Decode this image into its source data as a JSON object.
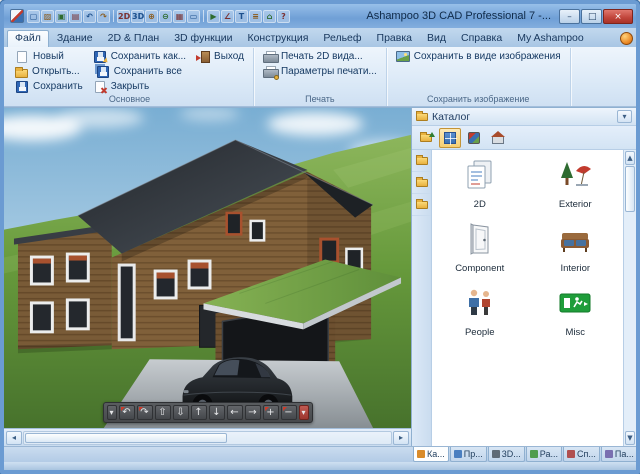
{
  "window": {
    "title": "Ashampoo 3D CAD Professional 7 -...",
    "controls": {
      "minimize": "–",
      "maximize": "□",
      "close": "×"
    }
  },
  "qat": {
    "icons": [
      {
        "name": "new-document-icon",
        "glyph": "▢"
      },
      {
        "name": "open-project-icon",
        "glyph": "▨"
      },
      {
        "name": "save-icon",
        "glyph": "▣"
      },
      {
        "name": "print-icon",
        "glyph": "▤"
      },
      {
        "name": "undo-icon",
        "glyph": "↶"
      },
      {
        "name": "redo-icon",
        "glyph": "↷"
      },
      {
        "name": "view-2d-icon",
        "glyph": "2D"
      },
      {
        "name": "view-3d-icon",
        "glyph": "3D"
      },
      {
        "name": "zoom-in-icon",
        "glyph": "⊕"
      },
      {
        "name": "zoom-out-icon",
        "glyph": "⊖"
      },
      {
        "name": "grid-icon",
        "glyph": "▦"
      },
      {
        "name": "ruler-icon",
        "glyph": "▭"
      },
      {
        "name": "selection-arrow-icon",
        "glyph": "▶"
      },
      {
        "name": "measure-icon",
        "glyph": "∠"
      },
      {
        "name": "text-icon",
        "glyph": "T"
      },
      {
        "name": "layers-icon",
        "glyph": "≡"
      },
      {
        "name": "home-view-icon",
        "glyph": "⌂"
      },
      {
        "name": "help-icon",
        "glyph": "?"
      }
    ]
  },
  "ribbon": {
    "tabs": [
      "Файл",
      "Здание",
      "2D & План",
      "3D функции",
      "Конструкция",
      "Рельеф",
      "Правка",
      "Вид",
      "Справка",
      "My Ashampoo"
    ],
    "active_tab": "Файл",
    "groups": {
      "main": {
        "label": "Основное",
        "buttons": [
          "Новый",
          "Открыть...",
          "Сохранить",
          "Сохранить как...",
          "Сохранить все",
          "Закрыть",
          "Выход"
        ]
      },
      "print": {
        "label": "Печать",
        "buttons": [
          "Печать 2D вида...",
          "Параметры печати..."
        ]
      },
      "save_image": {
        "label": "Сохранить изображение",
        "buttons": [
          "Сохранить в виде изображения"
        ]
      }
    }
  },
  "viewport": {
    "nav": [
      {
        "name": "nav-menu-left-icon",
        "glyph": "▾"
      },
      {
        "name": "rotate-left-icon",
        "glyph": "↶"
      },
      {
        "name": "rotate-right-icon",
        "glyph": "↷"
      },
      {
        "name": "tilt-up-icon",
        "glyph": "⇧"
      },
      {
        "name": "tilt-down-icon",
        "glyph": "⇩"
      },
      {
        "name": "move-up-icon",
        "glyph": "↑"
      },
      {
        "name": "move-down-icon",
        "glyph": "↓"
      },
      {
        "name": "move-left-icon",
        "glyph": "←"
      },
      {
        "name": "move-right-icon",
        "glyph": "→"
      },
      {
        "name": "zoom-in-nav-icon",
        "glyph": "+"
      },
      {
        "name": "zoom-out-nav-icon",
        "glyph": "−"
      },
      {
        "name": "nav-menu-right-icon",
        "glyph": "▾"
      }
    ],
    "hscroll": {
      "left": "◂",
      "right": "▸"
    }
  },
  "catalog": {
    "title": "Каталог",
    "options_glyph": "▾",
    "toolbar": [
      {
        "name": "folder-up-icon"
      },
      {
        "name": "grid-view-icon"
      },
      {
        "name": "materials-icon"
      },
      {
        "name": "home-icon"
      }
    ],
    "scrollbar": {
      "up": "▲",
      "down": "▼"
    },
    "items": [
      {
        "label": "2D"
      },
      {
        "label": "Exterior"
      },
      {
        "label": "Component"
      },
      {
        "label": "Interior"
      },
      {
        "label": "People"
      },
      {
        "label": "Misc"
      }
    ]
  },
  "dock_tabs": [
    {
      "label": "Ка..."
    },
    {
      "label": "Пр..."
    },
    {
      "label": "3D..."
    },
    {
      "label": "Ра..."
    },
    {
      "label": "Сп..."
    },
    {
      "label": "Па..."
    }
  ],
  "colors": {
    "titlebar": "#7fa9dc",
    "close_button": "#c0443a",
    "ribbon_bg": "#dcebf9",
    "selection_orange": "#f6cf72",
    "sky": "#87b6d7",
    "grass": "#5c8f3a",
    "roof": "#2f343a",
    "wood": "#7c5d38",
    "green_roof": "#76a447"
  }
}
